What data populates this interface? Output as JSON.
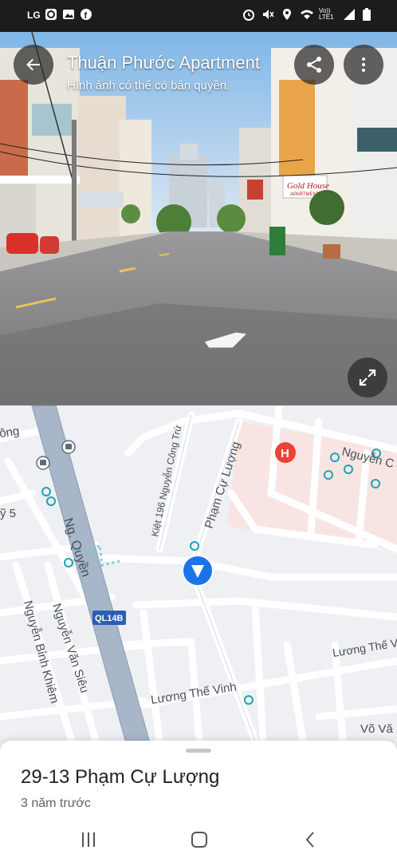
{
  "status_bar": {
    "left_icons": [
      "brand-logo-icon",
      "refresh-app-icon",
      "gallery-icon",
      "facebook-icon"
    ],
    "right_icons": [
      "alarm-icon",
      "mute-icon",
      "location-icon",
      "wifi-icon",
      "volte-icon",
      "signal-icon",
      "battery-icon"
    ],
    "network_label": "Vo)) LTE1"
  },
  "street_view": {
    "title": "Thuận Phước Apartment",
    "subtitle": "Hình ảnh có thể có bản quyền.",
    "shop_sign": "Gold House",
    "shop_sign_sub": "APARTMENT"
  },
  "map": {
    "streets": [
      "Ng. Quyền",
      "Kiệt 196 Nguyễn Công Trứ",
      "Phạm Cự Lượng",
      "Nguyễn Văn Siêu",
      "Nguyễn Bỉnh Khiêm",
      "Lương Thế Vinh",
      "Lương Thế V",
      "Nguyễn C",
      "Võ Vă",
      "ông",
      "ỹ 5"
    ],
    "route_badge": "QL14B",
    "hospital_marker": "H"
  },
  "bottom_sheet": {
    "address": "29-13 Phạm Cự Lượng",
    "time_ago": "3 năm trước"
  },
  "colors": {
    "accent_blue": "#1a73e8",
    "hospital_red": "#ea4335",
    "poi_teal": "#1aa5b3",
    "highway_fill": "#a8b6c9"
  }
}
